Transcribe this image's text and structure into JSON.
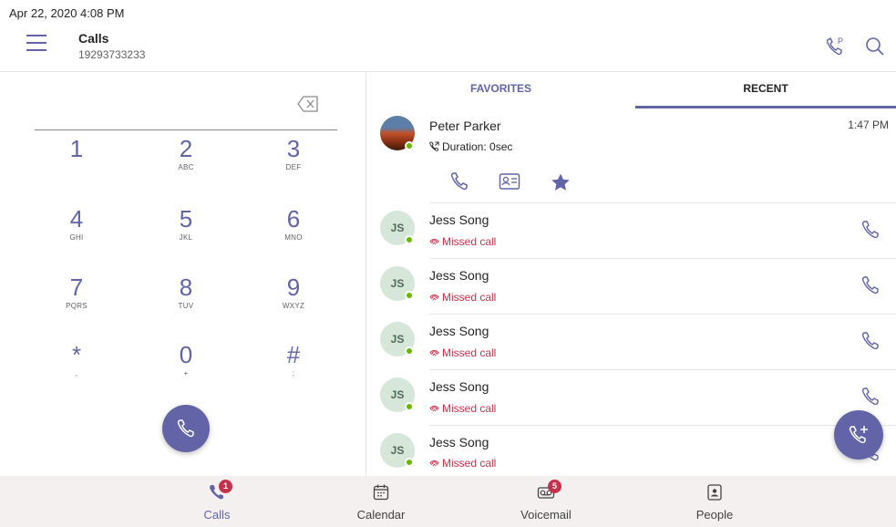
{
  "status_bar": {
    "datetime": "Apr 22, 2020  4:08 PM"
  },
  "header": {
    "title": "Calls",
    "number": "19293733233",
    "icons": [
      "menu-icon",
      "call-park-icon",
      "search-icon"
    ]
  },
  "dialpad": {
    "keys": [
      {
        "digit": "1",
        "letters": ""
      },
      {
        "digit": "2",
        "letters": "ABC"
      },
      {
        "digit": "3",
        "letters": "DEF"
      },
      {
        "digit": "4",
        "letters": "GHI"
      },
      {
        "digit": "5",
        "letters": "JKL"
      },
      {
        "digit": "6",
        "letters": "MNO"
      },
      {
        "digit": "7",
        "letters": "PQRS"
      },
      {
        "digit": "8",
        "letters": "TUV"
      },
      {
        "digit": "9",
        "letters": "WXYZ"
      },
      {
        "digit": "*",
        "letters": ","
      },
      {
        "digit": "0",
        "letters": "+"
      },
      {
        "digit": "#",
        "letters": ";"
      }
    ]
  },
  "tabs": {
    "favorites": "FAVORITES",
    "recent": "RECENT",
    "active": "RECENT"
  },
  "recent": {
    "featured": {
      "name": "Peter Parker",
      "duration": "Duration: 0sec",
      "time": "1:47 PM",
      "actions": [
        "phone-icon",
        "contact-card-icon",
        "star-icon"
      ]
    },
    "items": [
      {
        "initials": "JS",
        "name": "Jess Song",
        "status": "Missed call"
      },
      {
        "initials": "JS",
        "name": "Jess Song",
        "status": "Missed call"
      },
      {
        "initials": "JS",
        "name": "Jess Song",
        "status": "Missed call"
      },
      {
        "initials": "JS",
        "name": "Jess Song",
        "status": "Missed call"
      },
      {
        "initials": "JS",
        "name": "Jess Song",
        "status": "Missed call"
      }
    ]
  },
  "bottom_nav": {
    "items": [
      {
        "label": "Calls",
        "badge": "1",
        "active": true
      },
      {
        "label": "Calendar",
        "badge": ""
      },
      {
        "label": "Voicemail",
        "badge": "5"
      },
      {
        "label": "People",
        "badge": ""
      }
    ]
  },
  "colors": {
    "accent": "#6264a7",
    "missed": "#c4314b",
    "presence": "#6bb700",
    "nav_bg": "#f5f0f0"
  }
}
